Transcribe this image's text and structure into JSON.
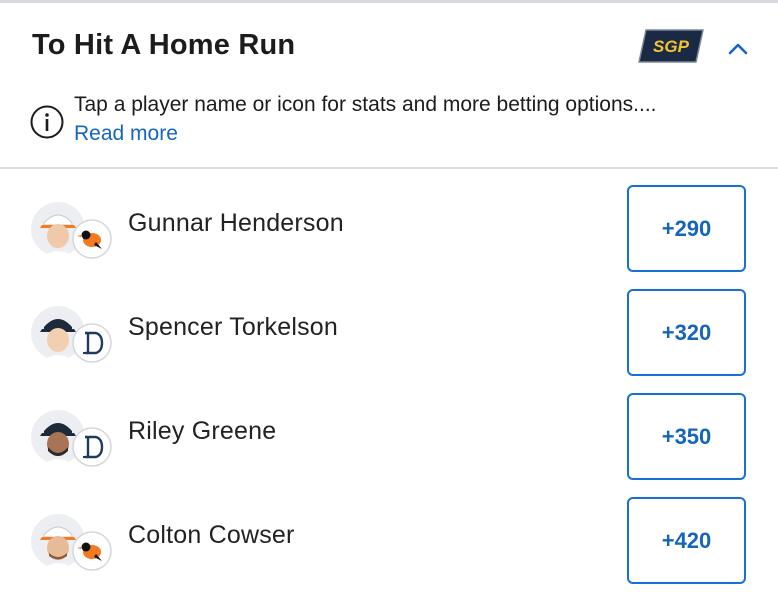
{
  "market": {
    "title": "To Hit A Home Run",
    "sgp_badge": "SGP",
    "info_text": "Tap a player name or icon for stats and more betting options....",
    "read_more": "Read more"
  },
  "colors": {
    "accent_blue": "#1565c0",
    "button_border": "#1a6fd6",
    "sgp_bg": "#1b2a44",
    "sgp_text": "#f2c230"
  },
  "players": [
    {
      "name": "Gunnar Henderson",
      "odds": "+290",
      "team_icon": "orioles-logo-icon"
    },
    {
      "name": "Spencer Torkelson",
      "odds": "+320",
      "team_icon": "tigers-logo-icon"
    },
    {
      "name": "Riley Greene",
      "odds": "+350",
      "team_icon": "tigers-logo-icon"
    },
    {
      "name": "Colton Cowser",
      "odds": "+420",
      "team_icon": "orioles-logo-icon"
    }
  ]
}
